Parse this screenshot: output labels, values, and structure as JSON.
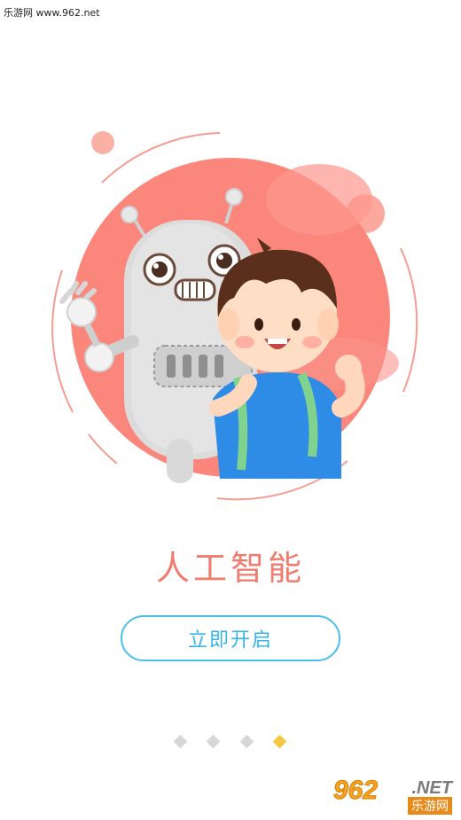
{
  "watermark": {
    "top_text": "乐游网 www.962.net"
  },
  "onboarding": {
    "title": "人工智能",
    "start_button_label": "立即开启",
    "page_indicator": {
      "total": 4,
      "active_index": 3
    }
  },
  "colors": {
    "accent_red": "#f07c6f",
    "circle_red": "#fb867c",
    "button_blue": "#38b4e6",
    "dot_inactive": "#d7d7d7",
    "dot_active": "#f5c83f"
  },
  "logo": {
    "number": "962",
    "suffix": ".NET",
    "chinese": "乐游网"
  }
}
